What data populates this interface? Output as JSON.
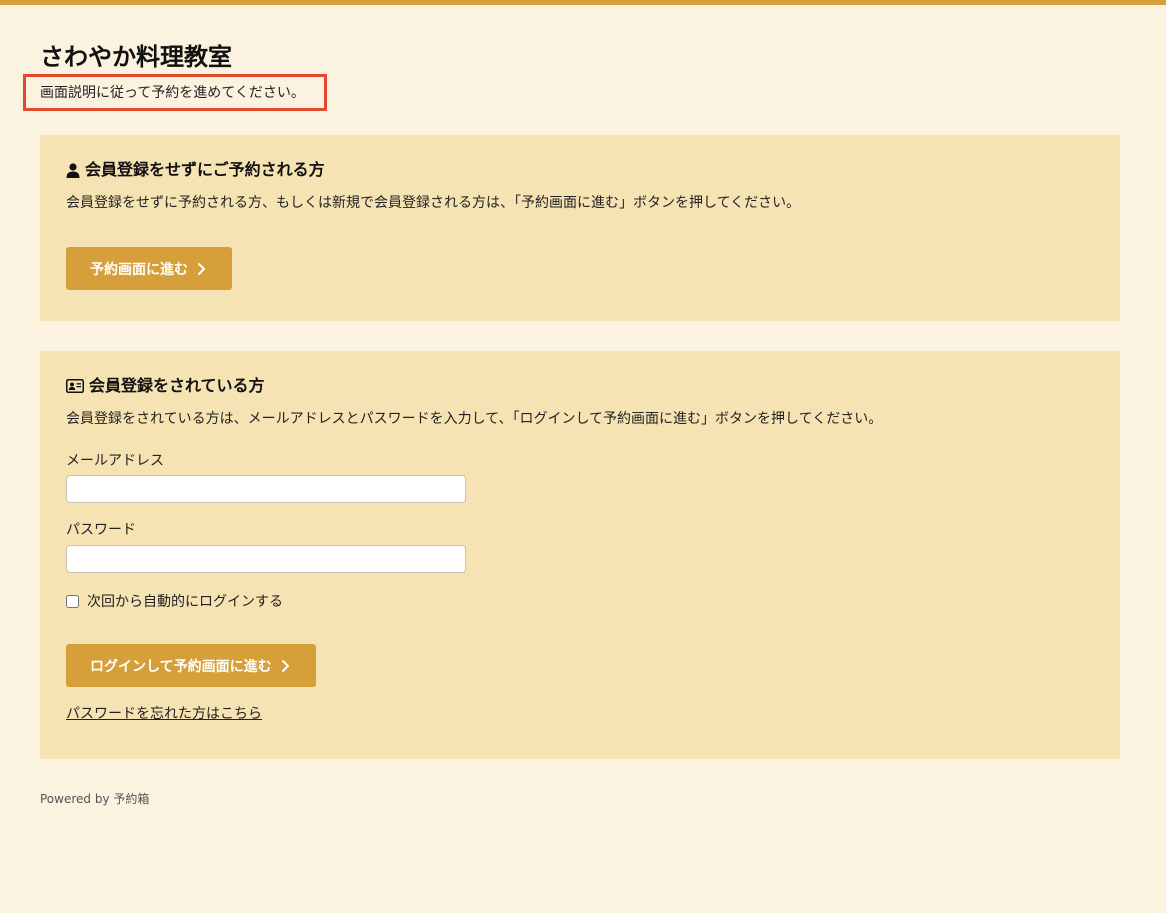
{
  "site": {
    "title": "さわやか料理教室",
    "instruction": "画面説明に従って予約を進めてください。"
  },
  "guest": {
    "heading": "会員登録をせずにご予約される方",
    "description": "会員登録をせずに予約される方、もしくは新規で会員登録される方は、「予約画面に進む」ボタンを押してください。",
    "button_label": "予約画面に進む",
    "icon": "user-icon"
  },
  "member": {
    "heading": "会員登録をされている方",
    "description": "会員登録をされている方は、メールアドレスとパスワードを入力して、「ログインして予約画面に進む」ボタンを押してください。",
    "email_label": "メールアドレス",
    "email_value": "",
    "password_label": "パスワード",
    "password_value": "",
    "remember_label": "次回から自動的にログインする",
    "remember_checked": false,
    "login_button_label": "ログインして予約画面に進む",
    "forgot_link": "パスワードを忘れた方はこちら",
    "icon": "id-card-icon"
  },
  "footer": {
    "powered_by": "Powered by 予約箱"
  },
  "colors": {
    "accent": "#d69f3a",
    "background": "#fbf2e0",
    "panel": "#f6e3b3",
    "highlight_border": "#e24a2c"
  }
}
